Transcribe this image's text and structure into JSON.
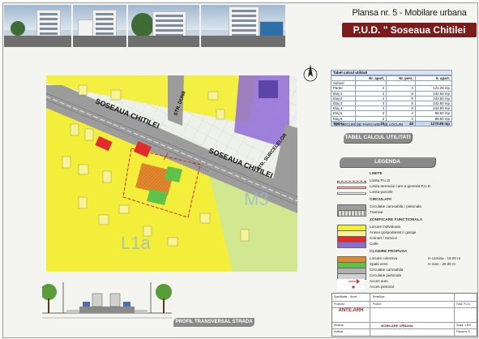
{
  "header": {
    "plansa_title": "Plansa nr. 5 - Mobilare urbana",
    "pud_title": "P.U.D. \" Soseaua Chitilei"
  },
  "calc_table": {
    "caption": "Tabel calcul utilitati",
    "columns": [
      "",
      "Nr. apart.",
      "Nr. pers.",
      "S. apart."
    ],
    "rows": [
      [
        "Subsol",
        "",
        "",
        ""
      ],
      [
        "Parter",
        "2",
        "4",
        "121.25 mp"
      ],
      [
        "Etaj 1",
        "4",
        "8",
        "242.60 mp"
      ],
      [
        "Etaj 2",
        "4",
        "8",
        "242.60 mp"
      ],
      [
        "Etaj 3",
        "4",
        "8",
        "242.60 mp"
      ],
      [
        "Etaj 4",
        "4",
        "8",
        "242.60 mp"
      ],
      [
        "Etaj 5",
        "2",
        "4",
        "89.60 mp"
      ],
      [
        "Etaj 6",
        "2",
        "4",
        "89.60 mp"
      ],
      [
        "TOTAL",
        "20",
        "48",
        "1270.85 mp"
      ]
    ],
    "parking": "NR. LOCURI DE PARCARE - 24 LOCURI"
  },
  "banners": {
    "tabel": "TABEL CALCUL UTILITATI",
    "legenda": "LEGENDA",
    "profil": "PROFIL TRANSVERSAL STRADA"
  },
  "legend": {
    "sections": [
      {
        "heading": "LIMITE",
        "items": [
          {
            "label": "Limita P.U.D.",
            "color": "#d9252a",
            "style": "dash"
          },
          {
            "label": "Limita terenului care a generat P.U.D.",
            "color": "#d9252a",
            "style": "line"
          },
          {
            "label": "Limita parcele",
            "color": "#9a9a9a",
            "style": "thin"
          }
        ]
      },
      {
        "heading": "CIRCULATII",
        "items": [
          {
            "label": "Circulatie carosabila / pietonala",
            "color": "#9c9c9c",
            "style": "fill"
          },
          {
            "label": "Tramvai",
            "color": "#d9d9d9",
            "style": "rail"
          }
        ]
      },
      {
        "heading": "ZONIFICARE FUNCTIONALA",
        "items": [
          {
            "label": "Locuire individuala",
            "color": "#f2ee3a",
            "style": "fill"
          },
          {
            "label": "Anexe gospodaresti / garaje",
            "color": "#f7f39a",
            "style": "fill"
          },
          {
            "label": "Comert / Servicii",
            "color": "#e32b2b",
            "style": "fill"
          },
          {
            "label": "Culte",
            "color": "#8f6bd6",
            "style": "fill"
          }
        ]
      },
      {
        "heading": "CLADIRE PROPUSA",
        "items": [
          {
            "label": "Locuire colectiva",
            "color": "#e2892f",
            "style": "fill"
          },
          {
            "label": "Spatii verzi",
            "color": "#5fc24a",
            "style": "fill"
          },
          {
            "label": "Circulatie carosabila",
            "color": "#b0b0b0",
            "style": "fill"
          },
          {
            "label": "Circulatie pietonala",
            "color": "#d0d0d0",
            "style": "fill"
          },
          {
            "label": "Acces auto",
            "color": "#c0392b",
            "style": "arrow"
          },
          {
            "label": "Acces pietonal",
            "color": "#c0392b",
            "style": "dot"
          }
        ]
      }
    ],
    "heights": [
      "H cornisa - 19.00 m",
      "H max - 26.00 m"
    ]
  },
  "map": {
    "street_main_1": "SOSEAUA CHITILEI",
    "street_main_2": "SOSEAUA CHITILEI",
    "street_duni": "STR. DUNII",
    "street_surcelelor": "STR. SURCELELOR",
    "zone_label_m3": "M3",
    "zone_label_l1a": "L1a"
  },
  "titleblock": {
    "logo": "ANTE.ARH",
    "logo_sub": "SRL",
    "beneficiar": "Beneficiar:",
    "proiect": "Proiect:",
    "faza": "Faza: P.U.D.",
    "plansa_nr": "Plansa nr. 5",
    "scara": "Scara: 1:500",
    "specificatie": "Specificatie",
    "nume": "Nume",
    "semnatura": "Semnatura",
    "proiectat": "Proiectat",
    "desenat": "Desenat",
    "verificat": "Verificat",
    "titlu_plansa": "MOBILARE URBANA"
  },
  "colors": {
    "accent": "#7a1c1c",
    "yellow_zone": "#f2ee3a",
    "purple_zone": "#8f6bd6",
    "proposed": "#e2892f",
    "green": "#5fc24a",
    "red_zone": "#e32b2b"
  }
}
